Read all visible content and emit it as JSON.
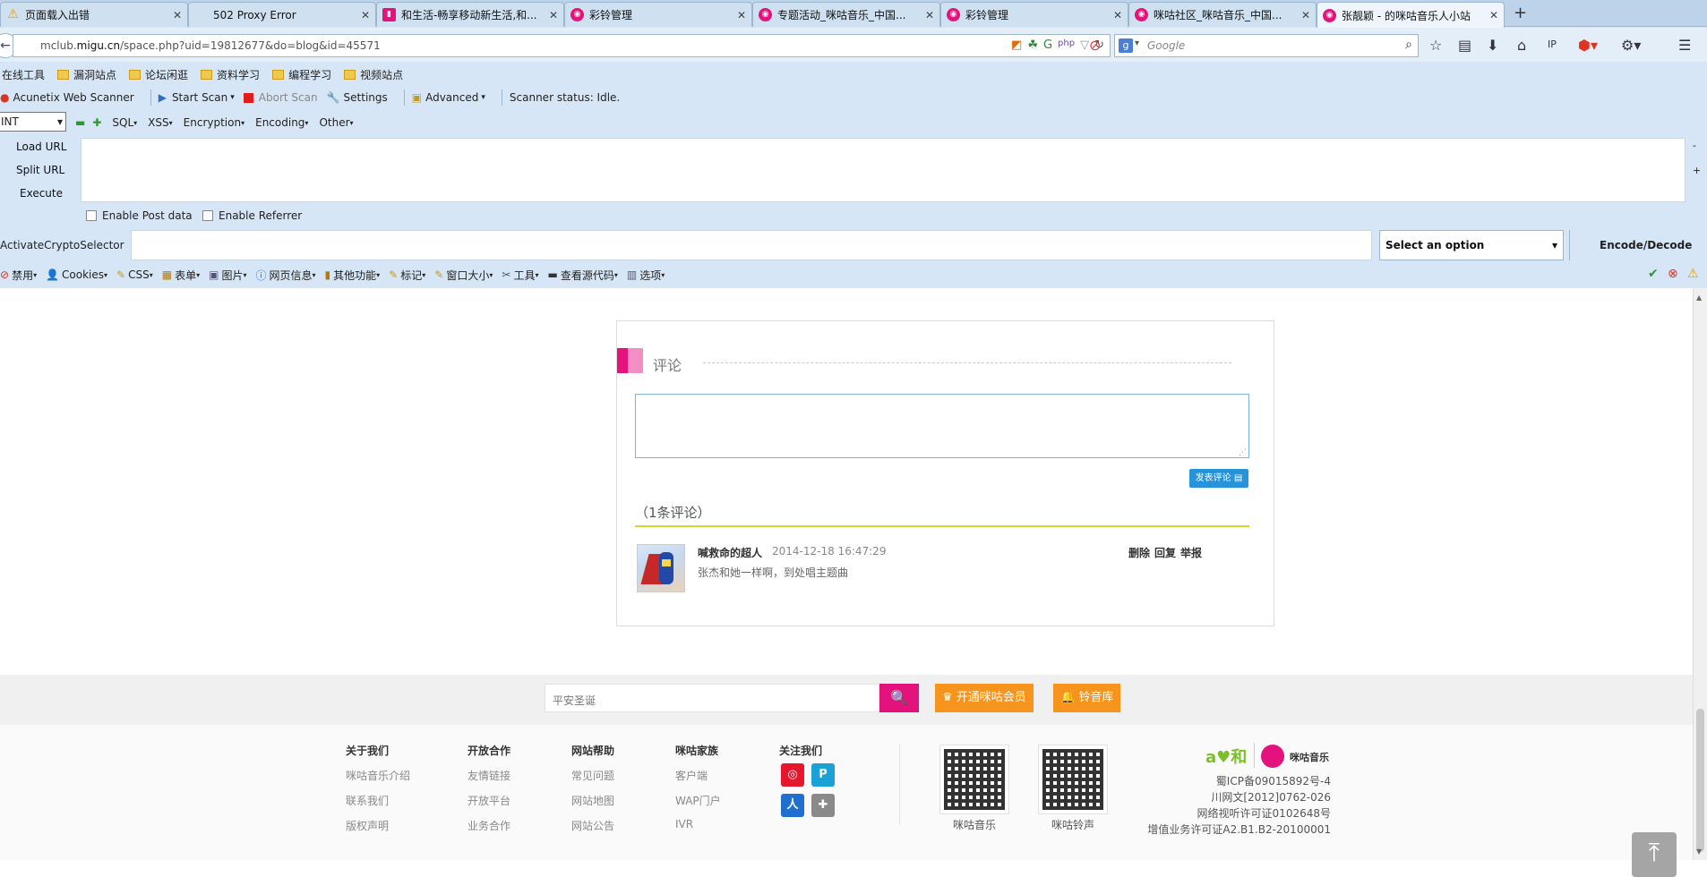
{
  "tabs": [
    {
      "title": "页面载入出错",
      "icon": "warning-icon"
    },
    {
      "title": "502 Proxy Error",
      "icon": "none"
    },
    {
      "title": "和生活-畅享移动新生活,和...",
      "icon": "bar-chart-icon"
    },
    {
      "title": "彩铃管理",
      "icon": "migu-icon"
    },
    {
      "title": "专题活动_咪咕音乐_中国...",
      "icon": "migu-icon"
    },
    {
      "title": "彩铃管理",
      "icon": "migu-icon"
    },
    {
      "title": "咪咕社区_咪咕音乐_中国...",
      "icon": "migu-icon"
    },
    {
      "title": "张靓颖 - 的咪咕音乐人小站",
      "icon": "migu-icon"
    }
  ],
  "nav": {
    "url_prefix": "mclub.",
    "url_domain": "migu.cn",
    "url_path": "/space.php?uid=19812677&do=blog&id=45571",
    "search_placeholder": "Google"
  },
  "bookmarks": [
    "在线工具",
    "漏洞站点",
    "论坛闲逛",
    "资料学习",
    "编程学习",
    "视频站点"
  ],
  "acunetix": {
    "name": "Acunetix Web Scanner",
    "start": "Start Scan",
    "abort": "Abort Scan",
    "settings": "Settings",
    "advanced": "Advanced",
    "status": "Scanner status: Idle."
  },
  "hackbar": {
    "select_value": "INT",
    "menus": [
      "SQL",
      "XSS",
      "Encryption",
      "Encoding",
      "Other"
    ],
    "load_url": "Load URL",
    "split_url": "Split URL",
    "execute": "Execute",
    "enable_post": "Enable Post data",
    "enable_referrer": "Enable Referrer",
    "crypto_label": "ActivateCryptoSelector",
    "crypto_select": "Select an option",
    "encode_decode": "Encode/Decode"
  },
  "webdev": [
    "禁用",
    "Cookies",
    "CSS",
    "表单",
    "图片",
    "网页信息",
    "其他功能",
    "标记",
    "窗口大小",
    "工具",
    "查看源代码",
    "选项"
  ],
  "comments": {
    "title": "评论",
    "submit": "发表评论",
    "count": "（1条评论）",
    "items": [
      {
        "user": "喊救命的超人",
        "time": "2014-12-18 16:47:29",
        "text": "张杰和她一样啊，到处唱主题曲"
      }
    ],
    "actions": [
      "删除",
      "回复",
      "举报"
    ]
  },
  "footer": {
    "search_placeholder": "平安圣诞",
    "member_btn": "开通咪咕会员",
    "ring_btn": "铃音库",
    "columns": [
      {
        "head": "关于我们",
        "links": [
          "咪咕音乐介绍",
          "联系我们",
          "版权声明"
        ]
      },
      {
        "head": "开放合作",
        "links": [
          "友情链接",
          "开放平台",
          "业务合作"
        ]
      },
      {
        "head": "网站帮助",
        "links": [
          "常见问题",
          "网站地图",
          "网站公告"
        ]
      },
      {
        "head": "咪咕家族",
        "links": [
          "客户端",
          "WAP门户",
          "IVR"
        ]
      },
      {
        "head": "关注我们",
        "links": []
      }
    ],
    "qr": [
      "咪咕音乐",
      "咪咕铃声"
    ],
    "logo_text": "咪咕音乐",
    "license": [
      "蜀ICP备09015892号-4",
      "川网文[2012]0762-026",
      "网络视听许可证0102648号",
      "增值业务许可证A2.B1.B2-20100001"
    ]
  },
  "colors": {
    "migu_pink": "#e3127d",
    "orange": "#f7941d",
    "submit_blue": "#2794d9"
  }
}
